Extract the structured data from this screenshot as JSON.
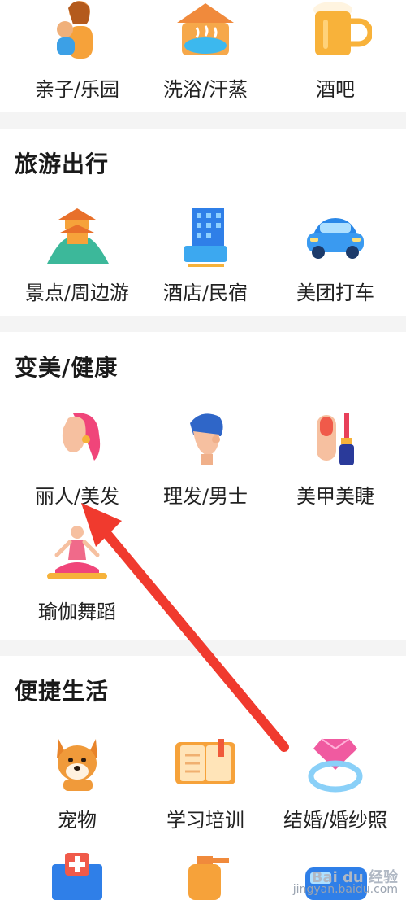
{
  "sections": [
    {
      "title": "",
      "items": [
        {
          "label": "亲子/乐园",
          "icon": "mother-child-icon"
        },
        {
          "label": "洗浴/汗蒸",
          "icon": "hot-spring-icon"
        },
        {
          "label": "酒吧",
          "icon": "beer-mug-icon"
        }
      ]
    },
    {
      "title": "旅游出行",
      "items": [
        {
          "label": "景点/周边游",
          "icon": "pagoda-icon"
        },
        {
          "label": "酒店/民宿",
          "icon": "hotel-building-icon"
        },
        {
          "label": "美团打车",
          "icon": "car-icon"
        }
      ]
    },
    {
      "title": "变美/健康",
      "items": [
        {
          "label": "丽人/美发",
          "icon": "woman-hair-icon"
        },
        {
          "label": "理发/男士",
          "icon": "man-haircut-icon"
        },
        {
          "label": "美甲美睫",
          "icon": "nail-polish-icon"
        },
        {
          "label": "瑜伽舞蹈",
          "icon": "yoga-icon"
        }
      ]
    },
    {
      "title": "便捷生活",
      "items": [
        {
          "label": "宠物",
          "icon": "dog-icon"
        },
        {
          "label": "学习培训",
          "icon": "book-icon"
        },
        {
          "label": "结婚/婚纱照",
          "icon": "diamond-ring-icon"
        }
      ]
    }
  ],
  "watermark": {
    "logo": "Bai du 经验",
    "url": "jingyan.baidu.com"
  },
  "colors": {
    "arrow": "#f03a2e",
    "section_bg": "#ffffff",
    "divider": "#f4f4f4"
  }
}
